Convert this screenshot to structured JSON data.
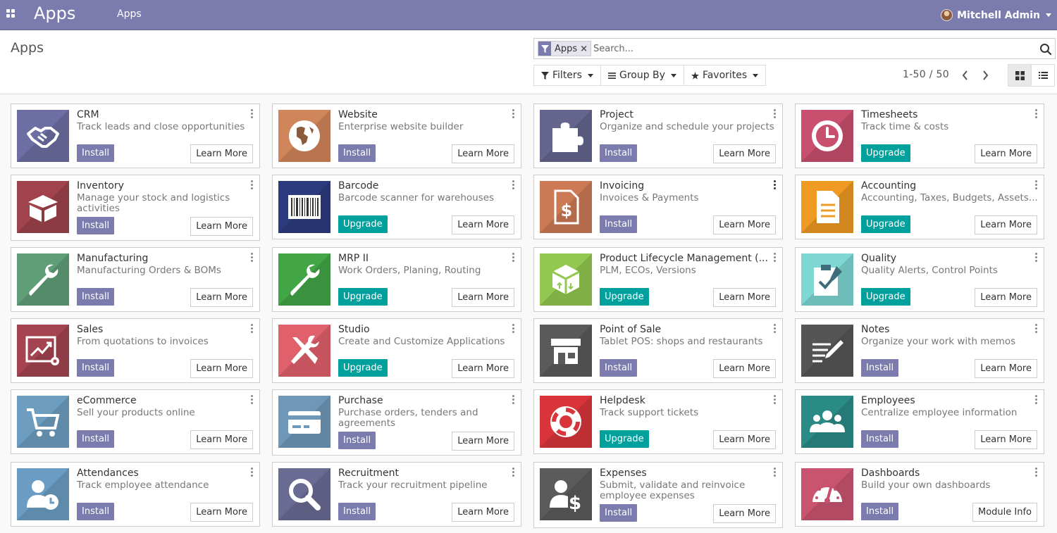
{
  "navbar": {
    "brand": "Apps",
    "menu": "Apps",
    "user": "Mitchell Admin"
  },
  "control": {
    "title": "Apps",
    "facet": "Apps",
    "search_placeholder": "Search...",
    "filters": "Filters",
    "group_by": "Group By",
    "favorites": "Favorites",
    "pager": "1-50 / 50"
  },
  "apps": [
    {
      "name": "CRM",
      "summary": "Track leads and close opportunities",
      "action": "Install",
      "info": "Learn More",
      "color": "#6d6ea3",
      "icon": "handshake-icon"
    },
    {
      "name": "Website",
      "summary": "Enterprise website builder",
      "action": "Install",
      "info": "Learn More",
      "color": "#d1855a",
      "icon": "globe-icon"
    },
    {
      "name": "Project",
      "summary": "Organize and schedule your projects",
      "action": "Install",
      "info": "Learn More",
      "color": "#65658e",
      "icon": "puzzle-icon"
    },
    {
      "name": "Timesheets",
      "summary": "Track time & costs",
      "action": "Upgrade",
      "info": "Learn More",
      "color": "#c94f6e",
      "icon": "clock-icon"
    },
    {
      "name": "Inventory",
      "summary": "Manage your stock and logistics activities",
      "action": "Install",
      "info": "Learn More",
      "color": "#a0434c",
      "icon": "box-icon"
    },
    {
      "name": "Barcode",
      "summary": "Barcode scanner for warehouses",
      "action": "Upgrade",
      "info": "Learn More",
      "color": "#2c3a7e",
      "icon": "barcode-icon"
    },
    {
      "name": "Invoicing",
      "summary": "Invoices & Payments",
      "action": "Install",
      "info": "Learn More",
      "color": "#cc7a56",
      "icon": "invoice-icon"
    },
    {
      "name": "Accounting",
      "summary": "Accounting, Taxes, Budgets, Assets...",
      "action": "Upgrade",
      "info": "Learn More",
      "color": "#ef9a22",
      "icon": "document-icon"
    },
    {
      "name": "Manufacturing",
      "summary": "Manufacturing Orders & BOMs",
      "action": "Install",
      "info": "Learn More",
      "color": "#5f9e77",
      "icon": "wrench-icon"
    },
    {
      "name": "MRP II",
      "summary": "Work Orders, Planing, Routing",
      "action": "Upgrade",
      "info": "Learn More",
      "color": "#43a646",
      "icon": "wrench-icon"
    },
    {
      "name": "Product Lifecycle Management (...",
      "summary": "PLM, ECOs, Versions",
      "action": "Upgrade",
      "info": "Learn More",
      "color": "#92c84f",
      "icon": "cube-icon"
    },
    {
      "name": "Quality",
      "summary": "Quality Alerts, Control Points",
      "action": "Upgrade",
      "info": "Learn More",
      "color": "#7ed7d3",
      "icon": "clipboard-check-icon"
    },
    {
      "name": "Sales",
      "summary": "From quotations to invoices",
      "action": "Install",
      "info": "Learn More",
      "color": "#a44450",
      "icon": "chart-icon"
    },
    {
      "name": "Studio",
      "summary": "Create and Customize Applications",
      "action": "Upgrade",
      "info": "Learn More",
      "color": "#e0606c",
      "icon": "tools-icon"
    },
    {
      "name": "Point of Sale",
      "summary": "Tablet POS: shops and restaurants",
      "action": "Install",
      "info": "Learn More",
      "color": "#5a5a5a",
      "icon": "shop-icon"
    },
    {
      "name": "Notes",
      "summary": "Organize your work with memos",
      "action": "Install",
      "info": "Learn More",
      "color": "#555555",
      "icon": "note-pen-icon"
    },
    {
      "name": "eCommerce",
      "summary": "Sell your products online",
      "action": "Install",
      "info": "Learn More",
      "color": "#6d9ec0",
      "icon": "cart-icon"
    },
    {
      "name": "Purchase",
      "summary": "Purchase orders, tenders and agreements",
      "action": "Install",
      "info": "Learn More",
      "color": "#6f98b8",
      "icon": "credit-card-icon"
    },
    {
      "name": "Helpdesk",
      "summary": "Track support tickets",
      "action": "Upgrade",
      "info": "Learn More",
      "color": "#d9343a",
      "icon": "lifebuoy-icon"
    },
    {
      "name": "Employees",
      "summary": "Centralize employee information",
      "action": "Install",
      "info": "Learn More",
      "color": "#2a8a86",
      "icon": "users-icon"
    },
    {
      "name": "Attendances",
      "summary": "Track employee attendance",
      "action": "Install",
      "info": "Learn More",
      "color": "#6b9dc4",
      "icon": "user-clock-icon"
    },
    {
      "name": "Recruitment",
      "summary": "Track your recruitment pipeline",
      "action": "Install",
      "info": "Learn More",
      "color": "#6a6b93",
      "icon": "magnifier-icon"
    },
    {
      "name": "Expenses",
      "summary": "Submit, validate and reinvoice employee expenses",
      "action": "Install",
      "info": "Learn More",
      "color": "#5b5b5b",
      "icon": "user-dollar-icon"
    },
    {
      "name": "Dashboards",
      "summary": "Build your own dashboards",
      "action": "Install",
      "info": "Module Info",
      "color": "#c9546f",
      "icon": "gauge-icon"
    }
  ]
}
